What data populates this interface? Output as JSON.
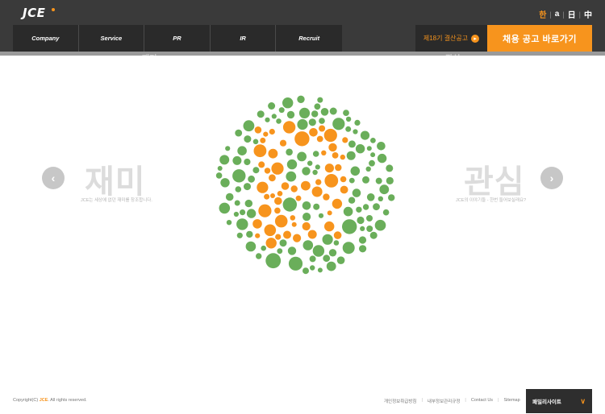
{
  "header": {
    "logo": "JCE",
    "languages": [
      "한",
      "a",
      "日",
      "中"
    ],
    "nav": [
      "Company",
      "Service",
      "PR",
      "IR",
      "Recruit"
    ],
    "announcement": "제18기 결산공고",
    "recruit_button": "채용 공고 바로가기",
    "ghost_left": "재미",
    "ghost_right": "관심"
  },
  "slider": {
    "left_heading": "재미",
    "left_sub": "JCE는 세상에 없던 재미를 창조합니다.",
    "right_heading": "관심",
    "right_sub": "JCE의 이야기들 - 한번 들어보실래요?",
    "prev_icon": "chevron-left-icon",
    "next_icon": "chevron-right-icon",
    "plate": {
      "background_color": "#6aae5a",
      "foreground_color": "#f7941d",
      "figure": "F"
    }
  },
  "footer": {
    "copyright_prefix": "Copyright(C) ",
    "copyright_brand": "JCE",
    "copyright_suffix": ". All rights reserved.",
    "links": [
      "개인정보취급방침",
      "내부정보관리규정",
      "Contact Us",
      "Sitemap"
    ],
    "family_site": "패밀리사이트"
  },
  "colors": {
    "accent": "#f7941d",
    "header_bg": "#3a3a3a",
    "green": "#6aae5a"
  }
}
